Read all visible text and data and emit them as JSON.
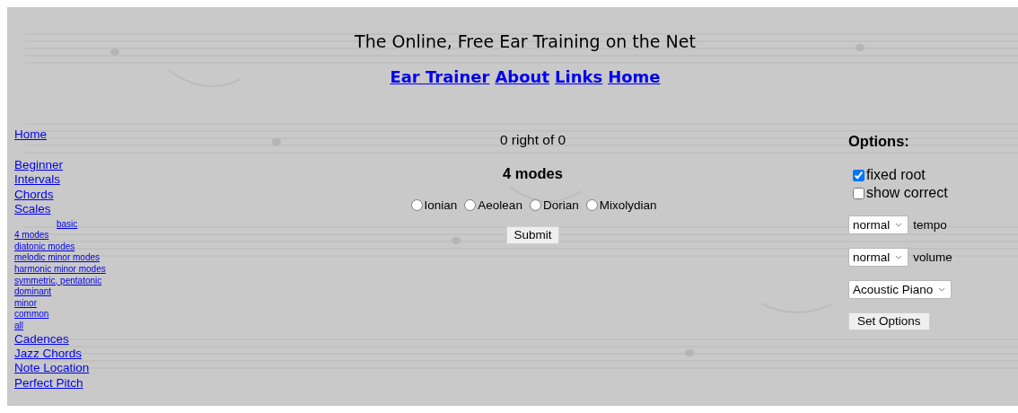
{
  "header": {
    "title": "The Online, Free Ear Training on the Net",
    "nav": [
      {
        "label": "Ear Trainer"
      },
      {
        "label": "About"
      },
      {
        "label": "Links"
      },
      {
        "label": "Home"
      }
    ]
  },
  "sidebar": {
    "home": "Home",
    "items": [
      {
        "label": "Beginner",
        "kind": "section"
      },
      {
        "label": "Intervals",
        "kind": "section"
      },
      {
        "label": "Chords",
        "kind": "section"
      },
      {
        "label": "Scales",
        "kind": "section"
      },
      {
        "label": "basic",
        "kind": "indented"
      },
      {
        "label": "4 modes",
        "kind": "sub"
      },
      {
        "label": "diatonic modes",
        "kind": "sub"
      },
      {
        "label": "melodic minor modes",
        "kind": "sub"
      },
      {
        "label": "harmonic minor modes",
        "kind": "sub"
      },
      {
        "label": "symmetric, pentatonic",
        "kind": "sub"
      },
      {
        "label": "dominant",
        "kind": "sub"
      },
      {
        "label": "minor",
        "kind": "sub"
      },
      {
        "label": "common",
        "kind": "sub"
      },
      {
        "label": "all",
        "kind": "sub"
      },
      {
        "label": "Cadences",
        "kind": "section"
      },
      {
        "label": "Jazz Chords",
        "kind": "section"
      },
      {
        "label": "Note Location",
        "kind": "section"
      },
      {
        "label": "Perfect Pitch",
        "kind": "section"
      }
    ]
  },
  "quiz": {
    "score": "0 right of 0",
    "heading": "4 modes",
    "choices": [
      {
        "label": "Ionian",
        "selected": false
      },
      {
        "label": "Aeolean",
        "selected": false
      },
      {
        "label": "Dorian",
        "selected": false
      },
      {
        "label": "Mixolydian",
        "selected": false
      }
    ],
    "submit": "Submit"
  },
  "options": {
    "title": "Options:",
    "checkboxes": [
      {
        "label": "fixed root",
        "checked": true
      },
      {
        "label": "show correct",
        "checked": false
      }
    ],
    "selects": [
      {
        "value": "normal",
        "label": "tempo"
      },
      {
        "value": "normal",
        "label": "volume"
      },
      {
        "value": "Acoustic Piano"
      }
    ],
    "button": "Set Options"
  }
}
